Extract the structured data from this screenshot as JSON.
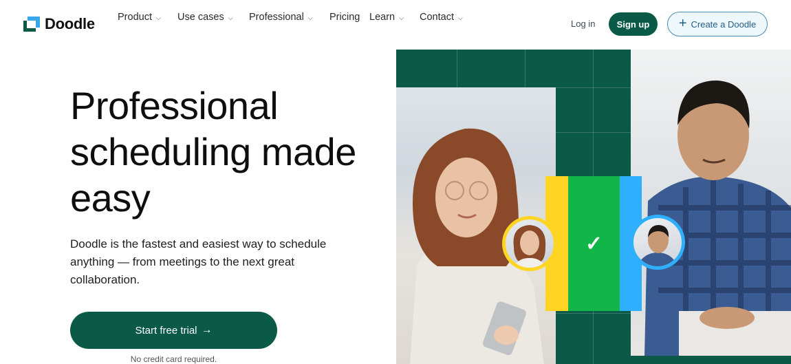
{
  "brand": {
    "name": "Doodle",
    "logo_icon": "doodle-logo-icon"
  },
  "nav": {
    "items": [
      {
        "label": "Product",
        "has_dropdown": true
      },
      {
        "label": "Use cases",
        "has_dropdown": true
      },
      {
        "label": "Professional",
        "has_dropdown": true
      },
      {
        "label": "Pricing",
        "has_dropdown": false
      },
      {
        "label": "Learn",
        "has_dropdown": true
      },
      {
        "label": "Contact",
        "has_dropdown": true
      }
    ],
    "chevron_glyph": "⌄",
    "login_label": "Log in",
    "signup_label": "Sign up",
    "create_label": "Create a Doodle",
    "create_icon_glyph": "+"
  },
  "hero": {
    "headline": "Professional scheduling made easy",
    "subtext": "Doodle is the fastest and easiest way to schedule anything — from meetings to the next great collaboration.",
    "cta_label": "Start free trial",
    "cta_arrow": "→",
    "note": "No credit card required.",
    "check_glyph": "✓"
  },
  "colors": {
    "brand_green": "#0b5a48",
    "logo_blue": "#3aa7ea",
    "accent_yellow": "#ffd524",
    "accent_green": "#12b548",
    "accent_blue": "#2fb0ff",
    "create_button_bg": "#eef7fc",
    "create_button_border": "#4a8db5"
  }
}
